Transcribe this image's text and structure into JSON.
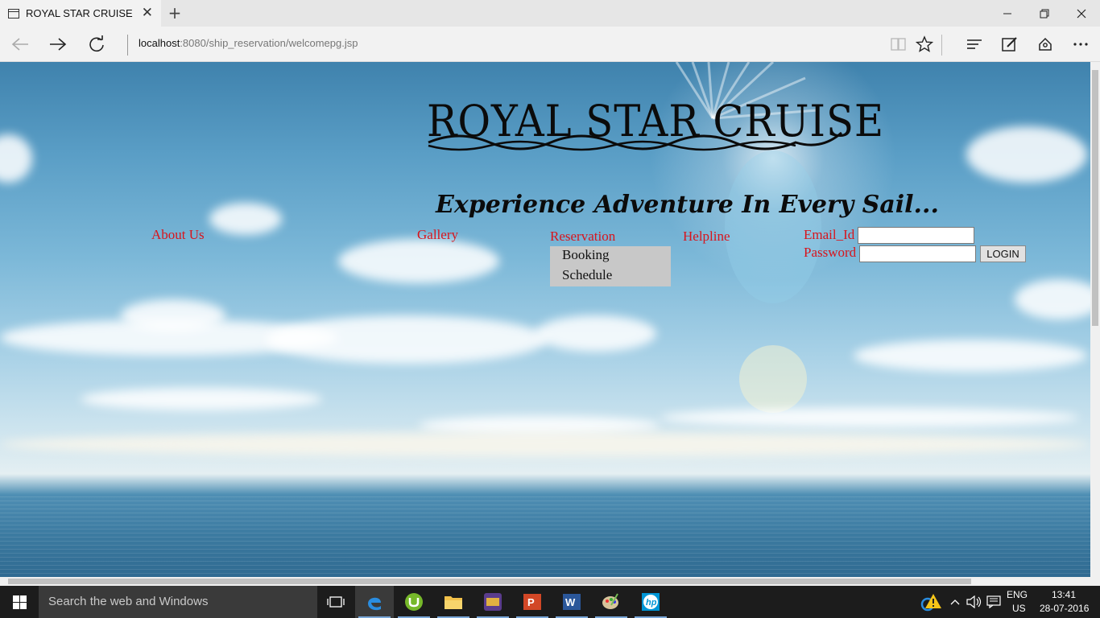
{
  "browser": {
    "tab_title": "ROYAL STAR CRUISE",
    "tab_close": "✕",
    "new_tab": "+",
    "address_host": "localhost",
    "address_rest": ":8080/ship_reservation/welcomepg.jsp",
    "icons": [
      "back-icon",
      "forward-icon",
      "refresh-icon",
      "reading-view-icon",
      "favorite-star-icon",
      "hub-icon",
      "web-note-icon",
      "share-icon",
      "more-icon"
    ]
  },
  "page": {
    "logo_text": "ROYAL STAR CRUISE",
    "tagline": "Experience Adventure In Every Sail...",
    "nav": {
      "about": "About Us",
      "gallery": "Gallery",
      "reservation": "Reservation",
      "helpline": "Helpline"
    },
    "dropdown": {
      "booking": "Booking",
      "schedule": "Schedule"
    },
    "login": {
      "email_label": "Email_Id",
      "password_label": "Password",
      "email_value": "",
      "password_value": "",
      "button": "LOGIN"
    },
    "colors": {
      "link": "#d8141c",
      "dropdown_bg": "#c8c8c8"
    }
  },
  "taskbar": {
    "search_placeholder": "Search the web and Windows",
    "language": "ENG",
    "region": "US",
    "time": "13:41",
    "date": "28-07-2016",
    "apps": [
      "task-view",
      "edge",
      "utorrent",
      "file-explorer",
      "media-app",
      "powerpoint",
      "word",
      "paint",
      "hp"
    ]
  }
}
